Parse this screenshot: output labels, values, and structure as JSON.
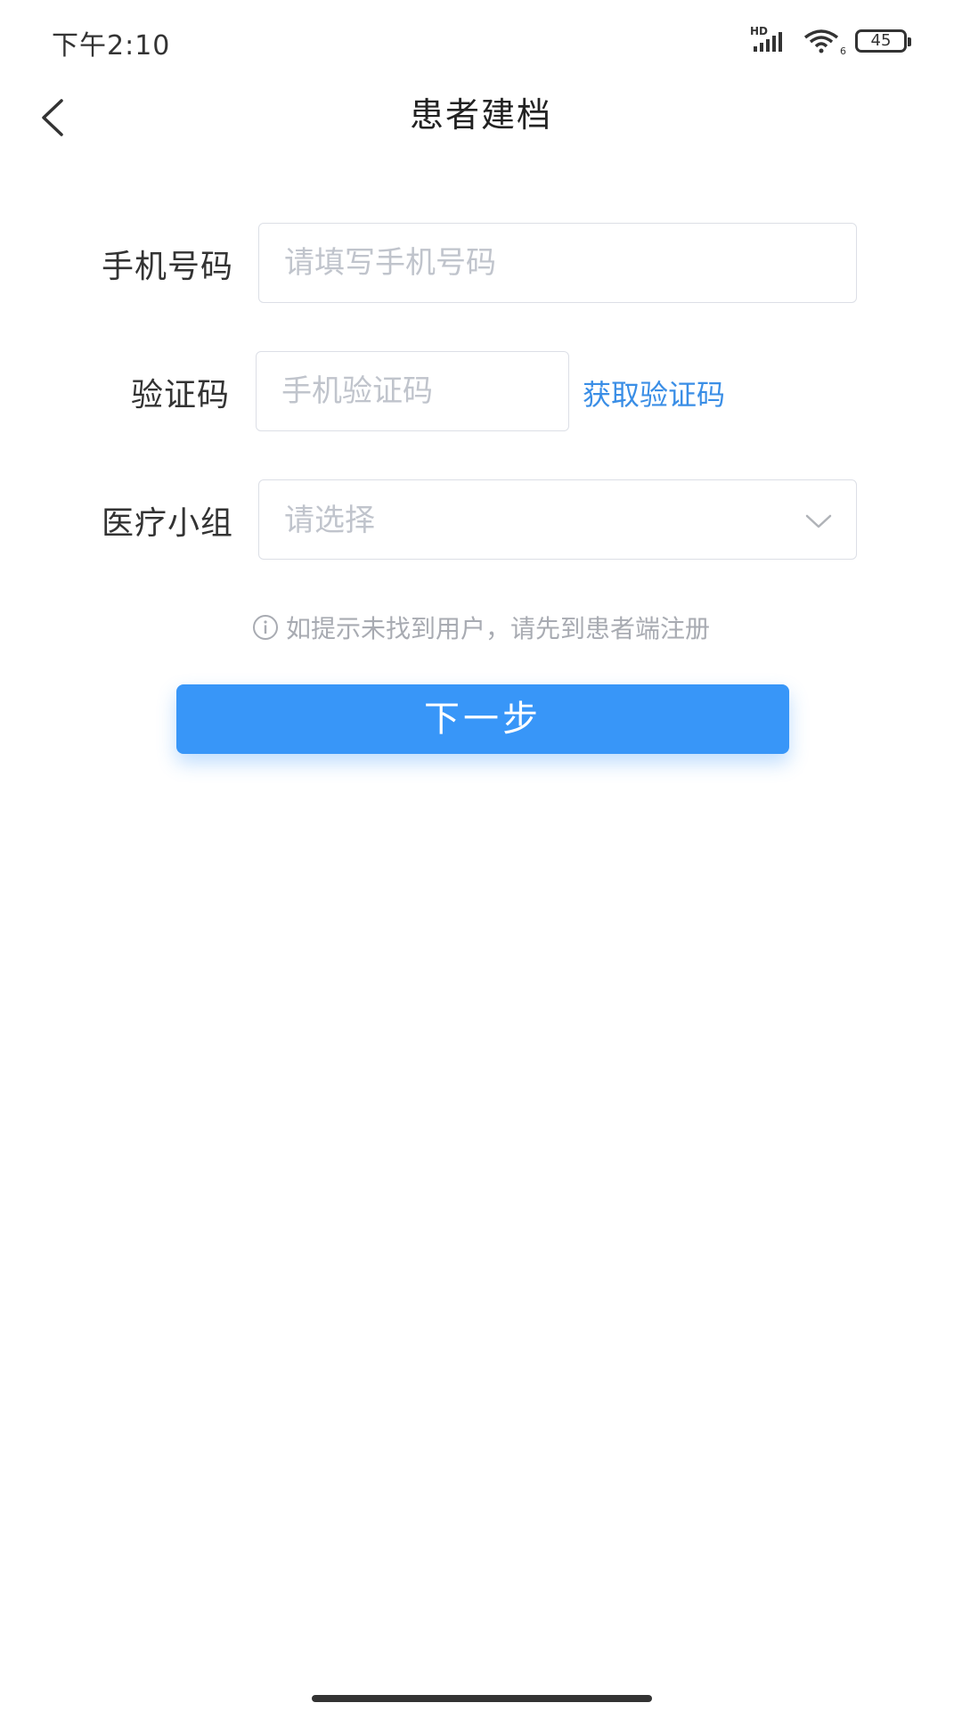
{
  "status_bar": {
    "time": "下午2:10",
    "network_label": "HD",
    "wifi_sub": "6",
    "battery": "45"
  },
  "nav": {
    "title": "患者建档"
  },
  "form": {
    "phone": {
      "label": "手机号码",
      "placeholder": "请填写手机号码",
      "value": ""
    },
    "code": {
      "label": "验证码",
      "placeholder": "手机验证码",
      "value": "",
      "get_code_label": "获取验证码"
    },
    "group": {
      "label": "医疗小组",
      "placeholder": "请选择"
    }
  },
  "hint": {
    "text": "如提示未找到用户，请先到患者端注册"
  },
  "next_button": {
    "label": "下一步"
  },
  "colors": {
    "primary": "#3896f8",
    "link": "#3a8ee6",
    "placeholder": "#c0c4cc",
    "border": "#dcdfe6"
  },
  "icons": {
    "back": "chevron-left-icon",
    "select": "chevron-down-icon",
    "info": "info-circle-icon"
  }
}
